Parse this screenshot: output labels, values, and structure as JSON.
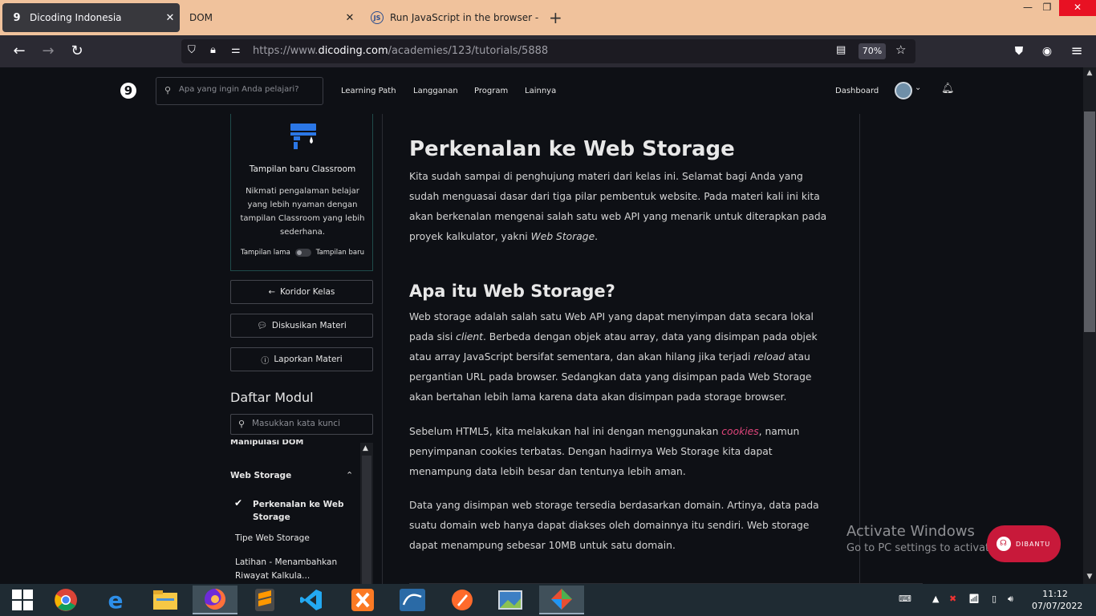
{
  "browser": {
    "tabs": [
      {
        "title": "Dicoding Indonesia",
        "favicon": "9"
      },
      {
        "title": "DOM",
        "favicon": ""
      },
      {
        "title": "Run JavaScript in the browser - ",
        "favicon": "JS"
      }
    ],
    "url_prefix": "https://www.",
    "url_domain": "dicoding.com",
    "url_path": "/academies/123/tutorials/5888",
    "zoom": "70%"
  },
  "header": {
    "logo": "9",
    "search_placeholder": "Apa yang ingin Anda pelajari?",
    "menu": [
      "Learning Path",
      "Langganan",
      "Program",
      "Lainnya"
    ],
    "dashboard": "Dashboard"
  },
  "sidebar": {
    "card_title": "Tampilan baru Classroom",
    "card_desc": "Nikmati pengalaman belajar yang lebih nyaman dengan tampilan Classroom yang lebih sederhana.",
    "toggle_left": "Tampilan lama",
    "toggle_right": "Tampilan baru",
    "buttons": [
      "Koridor Kelas",
      "Diskusikan Materi",
      "Laporkan Materi"
    ],
    "module_heading": "Daftar Modul",
    "module_search_placeholder": "Masukkan kata kunci",
    "modules": {
      "cut_item": "Manipulasi DOM",
      "section": "Web Storage",
      "items": [
        "Perkenalan ke Web Storage",
        "Tipe Web Storage",
        "Latihan - Menambahkan Riwayat Kalkula..."
      ]
    }
  },
  "content": {
    "title": "Perkenalan ke Web Storage",
    "intro": "Kita sudah sampai di penghujung materi dari kelas ini. Selamat bagi Anda yang sudah menguasai dasar dari tiga pilar pembentuk website. Pada materi kali ini  kita akan berkenalan mengenai salah satu web API yang menarik untuk diterapkan pada proyek kalkulator, yakni ",
    "intro_em": "Web Storage",
    "intro_end": ".",
    "h2": "Apa itu Web Storage?",
    "p1_a": "Web storage adalah salah satu Web API yang dapat menyimpan data secara lokal pada sisi ",
    "p1_em1": "client",
    "p1_b": ". Berbeda dengan objek atau array, data yang disimpan pada objek atau array JavaScript bersifat sementara, dan akan hilang jika terjadi ",
    "p1_em2": "reload",
    "p1_c": " atau pergantian URL pada browser. Sedangkan data yang disimpan pada Web Storage akan bertahan lebih lama karena data akan disimpan pada storage browser.",
    "p2_a": "Sebelum HTML5, kita melakukan hal ini dengan menggunakan ",
    "p2_link": "cookies",
    "p2_b": ", namun penyimpanan cookies terbatas. Dengan hadirnya Web Storage kita dapat menampung data lebih besar dan tentunya lebih aman.",
    "p3": "Data yang disimpan web storage tersedia berdasarkan domain. Artinya, data pada suatu domain web hanya dapat diakses oleh domainnya itu sendiri. Web storage dapat menampung sebesar 10MB untuk satu domain."
  },
  "overlay": {
    "activate_title": "Activate Windows",
    "activate_sub": "Go to PC settings to activate Windows.",
    "help_label": "DIBANTU"
  },
  "taskbar": {
    "time": "11:12",
    "date": "07/07/2022"
  }
}
